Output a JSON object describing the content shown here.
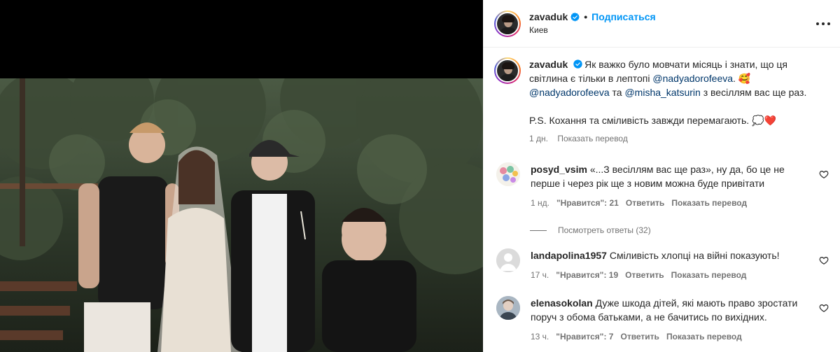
{
  "post": {
    "author": "zavaduk",
    "follow_label": "Подписаться",
    "separator": "•",
    "location": "Киев"
  },
  "caption": {
    "author": "zavaduk",
    "text_1": "Як важко було мовчати місяць і знати, що ця світлина є тільки в лептопі ",
    "mention_1": "@nadyadorofeeva",
    "text_2": ". 🥰 ",
    "mention_2": "@nadyadorofeeva",
    "text_3": " та ",
    "mention_3": "@misha_katsurin",
    "text_4": " з весіллям вас ще раз.",
    "ps": "P.S. Кохання та сміливість завжди перемагають. 💭❤️",
    "time": "1 дн.",
    "translate": "Показать перевод"
  },
  "comments": [
    {
      "author": "posyd_vsim",
      "text": "«...З весіллям вас ще раз», ну да, бо це не перше і через рік ще з новим можна буде привітати",
      "time": "1 нд.",
      "likes": "\"Нравится\": 21",
      "reply": "Ответить",
      "translate": "Показать перевод"
    },
    {
      "author": "landapolina1957",
      "text": "Сміливість хлопці на війні показують!",
      "time": "17 ч.",
      "likes": "\"Нравится\": 19",
      "reply": "Ответить",
      "translate": "Показать перевод"
    },
    {
      "author": "elenasokolan",
      "text": "Дуже шкода дітей, які мають право зростати поруч з обома батьками, а не бачитись по вихідних.",
      "time": "13 ч.",
      "likes": "\"Нравится\": 7",
      "reply": "Ответить",
      "translate": "Показать перевод"
    }
  ],
  "view_replies": "Посмотреть ответы (32)",
  "colors": {
    "accent": "#0095f6",
    "mention": "#00376b",
    "verified": "#0095f6",
    "muted": "#737373"
  },
  "icons": [
    "verified-badge-icon",
    "more-options-icon",
    "heart-icon"
  ]
}
